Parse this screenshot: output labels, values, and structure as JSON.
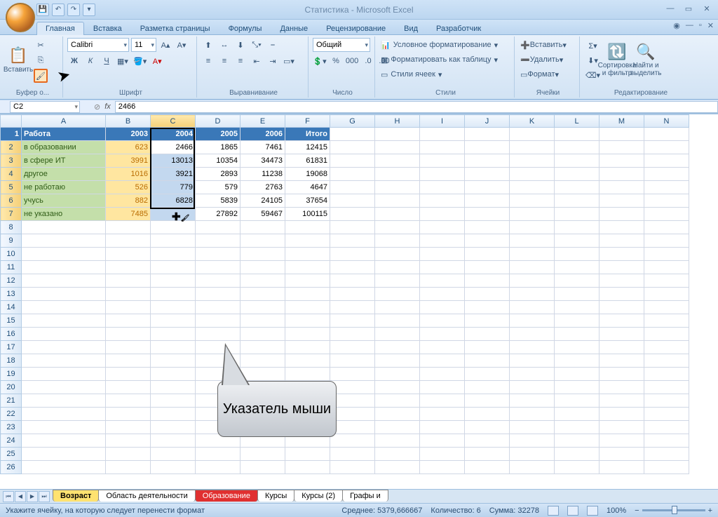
{
  "title": "Статистика - Microsoft Excel",
  "tabs": [
    "Главная",
    "Вставка",
    "Разметка страницы",
    "Формулы",
    "Данные",
    "Рецензирование",
    "Вид",
    "Разработчик"
  ],
  "ribbon": {
    "clipboard": {
      "paste": "Вставить",
      "label": "Буфер о..."
    },
    "font": {
      "name": "Calibri",
      "size": "11",
      "label": "Шрифт",
      "bold": "Ж",
      "italic": "К",
      "underline": "Ч"
    },
    "align": {
      "label": "Выравнивание"
    },
    "number": {
      "format": "Общий",
      "label": "Число"
    },
    "styles": {
      "cond": "Условное форматирование",
      "table": "Форматировать как таблицу",
      "cell": "Стили ячеек",
      "label": "Стили"
    },
    "cells": {
      "insert": "Вставить",
      "delete": "Удалить",
      "format": "Формат",
      "label": "Ячейки"
    },
    "editing": {
      "sort": "Сортировка и фильтр",
      "find": "Найти и выделить",
      "label": "Редактирование"
    }
  },
  "namebox": "C2",
  "formula": "2466",
  "cols": [
    "A",
    "B",
    "C",
    "D",
    "E",
    "F",
    "G",
    "H",
    "I",
    "J",
    "K",
    "L",
    "M",
    "N"
  ],
  "header": [
    "Работа",
    "2003",
    "2004",
    "2005",
    "2006",
    "Итого"
  ],
  "rows": [
    {
      "cat": "в образовании",
      "y": "623",
      "d": [
        "2466",
        "1865",
        "7461",
        "12415"
      ]
    },
    {
      "cat": "в сфере ИТ",
      "y": "3991",
      "d": [
        "13013",
        "10354",
        "34473",
        "61831"
      ]
    },
    {
      "cat": "другое",
      "y": "1016",
      "d": [
        "3921",
        "2893",
        "11238",
        "19068"
      ]
    },
    {
      "cat": "не работаю",
      "y": "526",
      "d": [
        "779",
        "579",
        "2763",
        "4647"
      ]
    },
    {
      "cat": "учусь",
      "y": "882",
      "d": [
        "6828",
        "5839",
        "24105",
        "37654"
      ]
    },
    {
      "cat": "не указано",
      "y": "7485",
      "d": [
        "",
        "27892",
        "59467",
        "100115"
      ]
    }
  ],
  "callout": "Указатель мыши",
  "sheets": [
    "Возраст",
    "Область деятельности",
    "Образование",
    "Курсы",
    "Курсы (2)",
    "Графы и"
  ],
  "status": {
    "msg": "Укажите ячейку, на которую следует перенести формат",
    "avg": "Среднее: 5379,666667",
    "cnt": "Количество: 6",
    "sum": "Сумма: 32278",
    "zoom": "100%"
  },
  "chart_data": {
    "type": "table",
    "title": "Работа",
    "categories": [
      "в образовании",
      "в сфере ИТ",
      "другое",
      "не работаю",
      "учусь",
      "не указано"
    ],
    "series": [
      {
        "name": "2003",
        "values": [
          623,
          3991,
          1016,
          526,
          882,
          7485
        ]
      },
      {
        "name": "2004",
        "values": [
          2466,
          13013,
          3921,
          779,
          6828,
          null
        ]
      },
      {
        "name": "2005",
        "values": [
          1865,
          10354,
          2893,
          579,
          5839,
          27892
        ]
      },
      {
        "name": "2006",
        "values": [
          7461,
          34473,
          11238,
          2763,
          24105,
          59467
        ]
      },
      {
        "name": "Итого",
        "values": [
          12415,
          61831,
          19068,
          4647,
          37654,
          100115
        ]
      }
    ]
  }
}
